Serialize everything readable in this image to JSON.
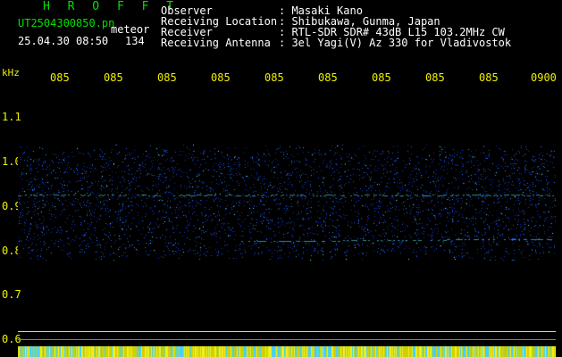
{
  "header": {
    "brand": "H R O F F T",
    "filename": "UT2504300850.pn",
    "tag": "meteor",
    "datetime": "25.04.30 08:50",
    "count": "134",
    "rows": [
      {
        "label": "Observer",
        "value": ": Masaki Kano"
      },
      {
        "label": "Receiving Location",
        "value": ": Shibukawa, Gunma, Japan"
      },
      {
        "label": "Receiver",
        "value": ": RTL-SDR SDR# 43dB L15 103.2MHz CW"
      },
      {
        "label": "Receiving Antenna",
        "value": ": 3el Yagi(V) Az 330 for Vladivostok"
      }
    ]
  },
  "axis": {
    "unit": "kHz",
    "x_ticks": [
      "085",
      "085",
      "085",
      "085",
      "085",
      "085",
      "085",
      "085",
      "085",
      "0900"
    ],
    "y_ticks": [
      "1.1",
      "1.0",
      "0.9",
      "0.8",
      "0.7",
      "0.6"
    ]
  },
  "colors": {
    "background": "#000000",
    "text_green": "#00e000",
    "text_yellow": "#f0f000",
    "noise_low": "#1030c0",
    "noise_high": "#30a0ff",
    "trace": "#40e0e0"
  }
}
